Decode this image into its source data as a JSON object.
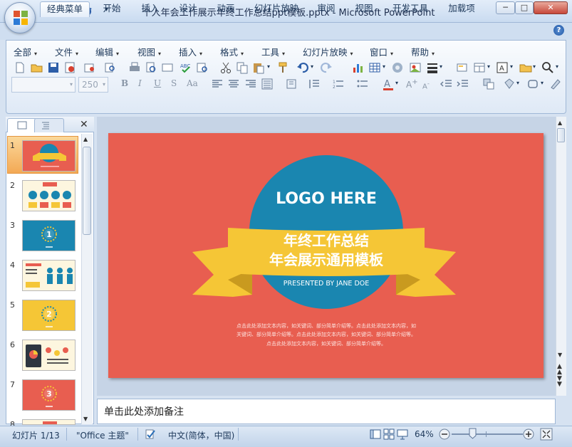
{
  "window": {
    "title": "个人年会工作展示年终工作总结ppt模板.pptx - Microsoft PowerPoint",
    "minimize": "─",
    "maximize": "□",
    "close": "✕"
  },
  "ribbon_tabs": [
    "经典菜单",
    "开始",
    "插入",
    "设计",
    "动画",
    "幻灯片放映",
    "审阅",
    "视图",
    "开发工具",
    "加载项"
  ],
  "menus": [
    "全部",
    "文件",
    "编辑",
    "视图",
    "插入",
    "格式",
    "工具",
    "幻灯片放映",
    "窗口",
    "帮助"
  ],
  "font_size": "250",
  "help": "?",
  "thumbnails": [
    {
      "num": "1",
      "kind": "title",
      "bg": "#e85e50"
    },
    {
      "num": "2",
      "kind": "circles",
      "bg": "#fdf6df"
    },
    {
      "num": "3",
      "kind": "section",
      "bg": "#1a86b0",
      "label": "1"
    },
    {
      "num": "4",
      "kind": "people",
      "bg": "#fdf6df"
    },
    {
      "num": "5",
      "kind": "section",
      "bg": "#f5c636",
      "label": "2"
    },
    {
      "num": "6",
      "kind": "chart",
      "bg": "#fdf6df"
    },
    {
      "num": "7",
      "kind": "section",
      "bg": "#e85e50",
      "label": "3"
    },
    {
      "num": "8",
      "kind": "circles",
      "bg": "#fdf6df"
    }
  ],
  "slide": {
    "logo": "LOGO HERE",
    "title_line1": "年终工作总结",
    "title_line2": "年会展示通用模板",
    "presented": "PRESENTED BY JANE DOE",
    "body_line1": "点击此处添加文本内容，如关键词、部分简单介绍等。点击此处添加文本内容，如",
    "body_line2": "关键词、部分简单介绍等。点击此处添加文本内容，如关键词、部分简单介绍等。",
    "body_line3": "点击此处添加文本内容，如关键词、部分简单介绍等。",
    "colors": {
      "background": "#e85e50",
      "circle": "#1a86b0",
      "ribbon": "#f5c636",
      "ribbon_shadow": "#c99a1f"
    }
  },
  "notes_placeholder": "单击此处添加备注",
  "status": {
    "slide_counter": "幻灯片 1/13",
    "theme": "\"Office 主题\"",
    "language": "中文(简体，中国)",
    "zoom": "64%"
  }
}
